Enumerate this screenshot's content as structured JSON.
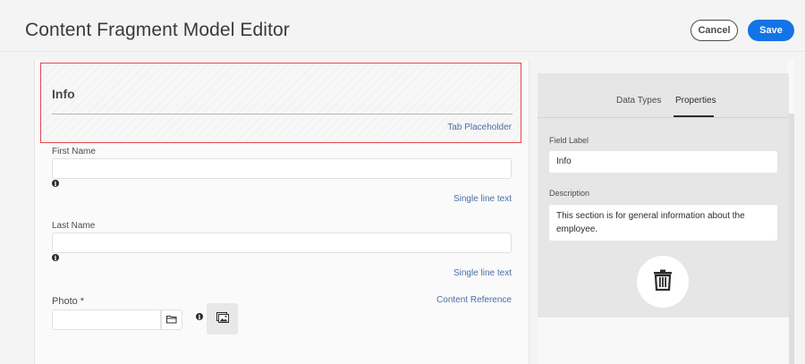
{
  "header": {
    "title": "Content Fragment Model Editor",
    "cancel_label": "Cancel",
    "save_label": "Save"
  },
  "tab_placeholder": {
    "title": "Info",
    "type": "Tab Placeholder"
  },
  "fields": [
    {
      "label": "First Name",
      "value": "",
      "type": "Single line text"
    },
    {
      "label": "Last Name",
      "value": "",
      "type": "Single line text"
    }
  ],
  "photo": {
    "label": "Photo *",
    "value": "",
    "type": "Content Reference"
  },
  "right_panel": {
    "tabs": [
      "Data Types",
      "Properties"
    ],
    "active_tab": "Properties",
    "field_label_label": "Field Label",
    "field_label_value": "Info",
    "description_label": "Description",
    "description_value": "This section is for general information about the employee."
  },
  "icons": {
    "info": "info-icon",
    "folder": "folder-icon",
    "image": "image-icon",
    "trash": "trash-icon"
  },
  "colors": {
    "primary": "#1473e6",
    "selection_border": "#e34850",
    "link": "#4a6fa5"
  }
}
